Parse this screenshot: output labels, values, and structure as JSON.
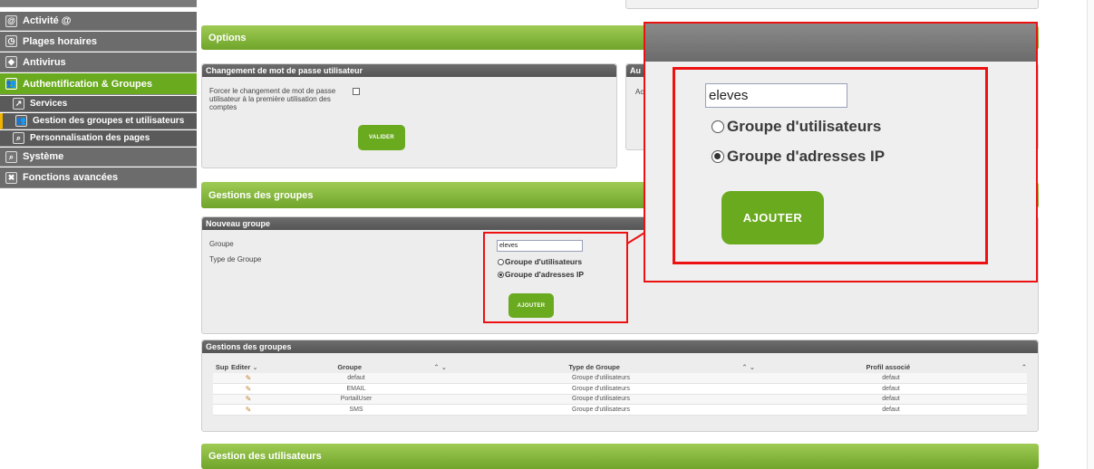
{
  "sidebar": {
    "items": [
      {
        "label": "Activité @",
        "icon": "globe-icon",
        "glyph": "@"
      },
      {
        "label": "Plages horaires",
        "icon": "clock-icon",
        "glyph": "◷"
      },
      {
        "label": "Antivirus",
        "icon": "shield-icon",
        "glyph": "◆"
      },
      {
        "label": "Authentification & Groupes",
        "icon": "users-icon",
        "glyph": "👥"
      },
      {
        "label": "Services",
        "icon": "chart-icon",
        "glyph": "↗"
      },
      {
        "label": "Gestion des groupes et utilisateurs",
        "icon": "users-icon",
        "glyph": "👥"
      },
      {
        "label": "Personnalisation des pages",
        "icon": "search-icon",
        "glyph": "⌕"
      },
      {
        "label": "Système",
        "icon": "search-icon",
        "glyph": "⌕"
      },
      {
        "label": "Fonctions avancées",
        "icon": "tools-icon",
        "glyph": "✖"
      }
    ]
  },
  "sections": {
    "options": "Options",
    "gestions_groupes": "Gestions des groupes",
    "gestion_utilisateurs": "Gestion des utilisateurs"
  },
  "password_panel": {
    "title": "Changement de mot de passe utilisateur",
    "label": "Forcer le changement de mot de passe utilisateur à la première utilisation des comptes",
    "button": "Valider"
  },
  "au_panel": {
    "title": "Au",
    "label": "Ac"
  },
  "new_group": {
    "title": "Nouveau groupe",
    "group_label": "Groupe",
    "type_label": "Type de Groupe",
    "group_value": "eleves",
    "option_users": "Groupe d'utilisateurs",
    "option_ip": "Groupe d'adresses IP",
    "button": "Ajouter"
  },
  "groups_table": {
    "title": "Gestions des groupes",
    "headers": [
      "Sup",
      "Editer",
      "Groupe",
      "Type de Groupe",
      "Profil associé"
    ],
    "rows": [
      {
        "group": "defaut",
        "type": "Groupe d'utilisateurs",
        "profile": "defaut"
      },
      {
        "group": "EMAIL",
        "type": "Groupe d'utilisateurs",
        "profile": "defaut"
      },
      {
        "group": "PortailUser",
        "type": "Groupe d'utilisateurs",
        "profile": "defaut"
      },
      {
        "group": "SMS",
        "type": "Groupe d'utilisateurs",
        "profile": "defaut"
      }
    ]
  },
  "zoom": {
    "group_value": "eleves",
    "option_users": "Groupe d'utilisateurs",
    "option_ip": "Groupe d'adresses IP",
    "button": "Ajouter"
  },
  "colors": {
    "accent_green": "#6aaa1f",
    "highlight_red": "#e11111",
    "sidebar_gray": "#6c6c6c"
  }
}
